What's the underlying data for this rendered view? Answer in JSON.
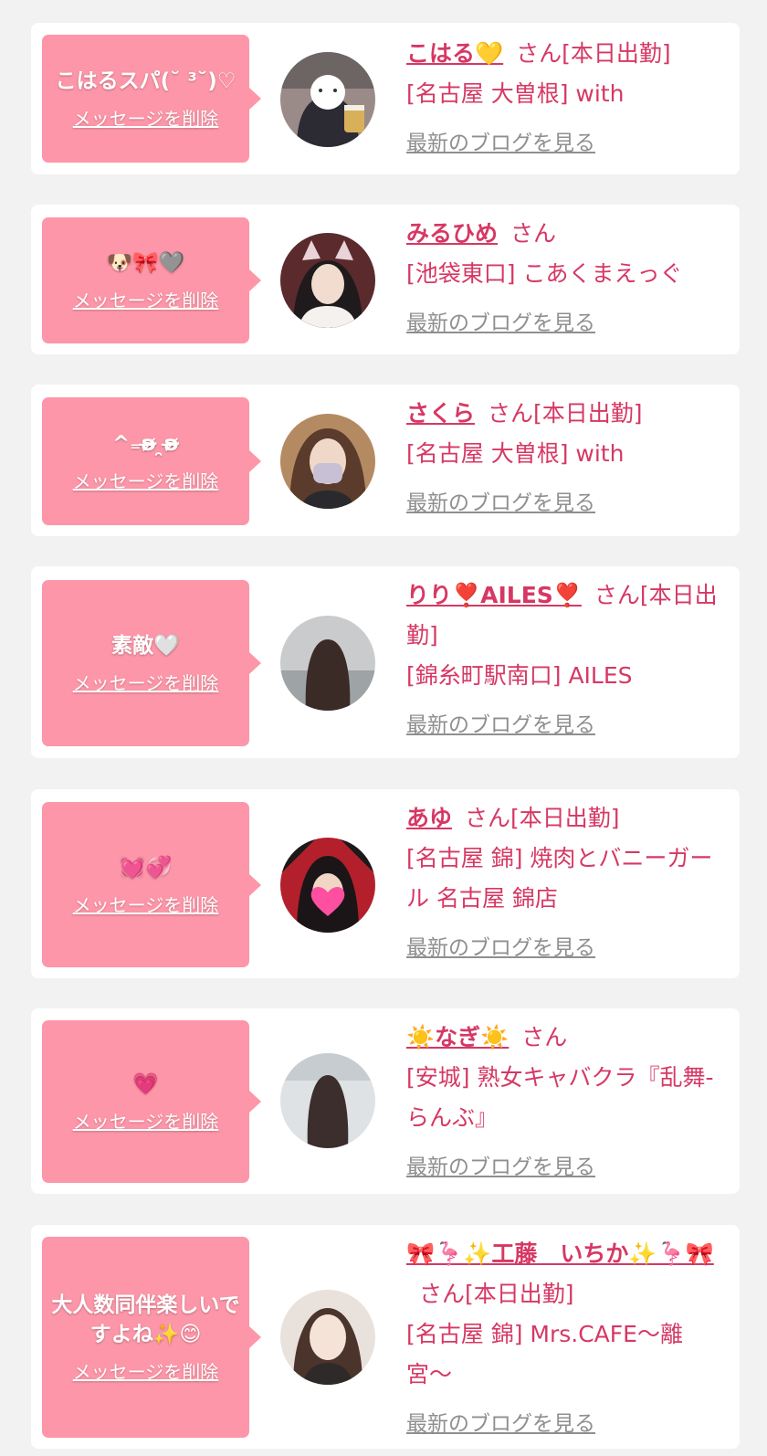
{
  "accent_color": "#fd96a8",
  "link_color": "#d63864",
  "muted_color": "#8f8f8f",
  "items": [
    {
      "message": "こはるスパ(˘ ³˘)♡",
      "delete_label": "メッセージを削除",
      "name": "こはる💛",
      "suffix": "さん[本日出勤]",
      "shop": "[名古屋 大曽根] with",
      "blog_label": "最新のブログを見る"
    },
    {
      "message": "🐶🎀🩶",
      "delete_label": "メッセージを削除",
      "name": "みるひめ",
      "suffix": "さん",
      "shop": "[池袋東口] こあくまえっぐ",
      "blog_label": "最新のブログを見る"
    },
    {
      "message": "^₌ʚ̴̶̷ ̯ʚ̴̶̷",
      "delete_label": "メッセージを削除",
      "name": "さくら",
      "suffix": "さん[本日出勤]",
      "shop": "[名古屋 大曽根] with",
      "blog_label": "最新のブログを見る"
    },
    {
      "message": "素敵🤍",
      "delete_label": "メッセージを削除",
      "name": "りり❣️AILES❣️",
      "suffix": "さん[本日出勤]",
      "shop": "[錦糸町駅南口] AILES",
      "blog_label": "最新のブログを見る"
    },
    {
      "message": "💓💞",
      "delete_label": "メッセージを削除",
      "name": "あゆ",
      "suffix": "さん[本日出勤]",
      "shop": "[名古屋 錦] 焼肉とバニーガール 名古屋 錦店",
      "blog_label": "最新のブログを見る"
    },
    {
      "message": "💗",
      "delete_label": "メッセージを削除",
      "name": "☀️なぎ☀️",
      "suffix": "さん",
      "shop": "[安城] 熟女キャバクラ『乱舞-らんぶ』",
      "blog_label": "最新のブログを見る"
    },
    {
      "message": "大人数同伴楽しいですよね✨😊",
      "delete_label": "メッセージを削除",
      "name": "🎀🦩✨工藤　いちか✨🦩🎀",
      "suffix": "さん[本日出勤]",
      "shop": "[名古屋 錦] Mrs.CAFE〜離宮〜",
      "blog_label": "最新のブログを見る"
    }
  ]
}
